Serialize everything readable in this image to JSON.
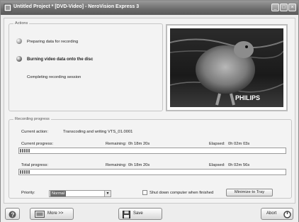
{
  "window": {
    "title": "Untitled Project * [DVD-Video] - NeroVision Express 3"
  },
  "actions": {
    "legend": "Actions",
    "items": [
      {
        "label": "Preparing data for recording"
      },
      {
        "label": "Burning video data onto the disc"
      },
      {
        "label": "Completing recording session"
      }
    ]
  },
  "preview": {
    "brand_text": "PHILIPS"
  },
  "progress": {
    "legend": "Recording progress",
    "current_action_label": "Current action:",
    "current_action_value": "Transcoding and writing VTS_01.0001",
    "current": {
      "label": "Current progress:",
      "remaining_label": "Remaining:",
      "remaining": "0h 18m 20s",
      "elapsed_label": "Elapsed:",
      "elapsed": "0h 02m 03s",
      "fraction": 0.04
    },
    "total": {
      "label": "Total progress:",
      "remaining_label": "Remaining:",
      "remaining": "0h 18m 20s",
      "elapsed_label": "Elapsed:",
      "elapsed": "0h 02m 56s",
      "fraction": 0.04
    }
  },
  "priority": {
    "label": "Priority:",
    "value": "Normal"
  },
  "shutdown": {
    "label": "Shut down computer when finished",
    "checked": false
  },
  "buttons": {
    "minimize": "Minimize to Tray",
    "more": "More >>",
    "save": "Save",
    "abort": "Abort"
  }
}
